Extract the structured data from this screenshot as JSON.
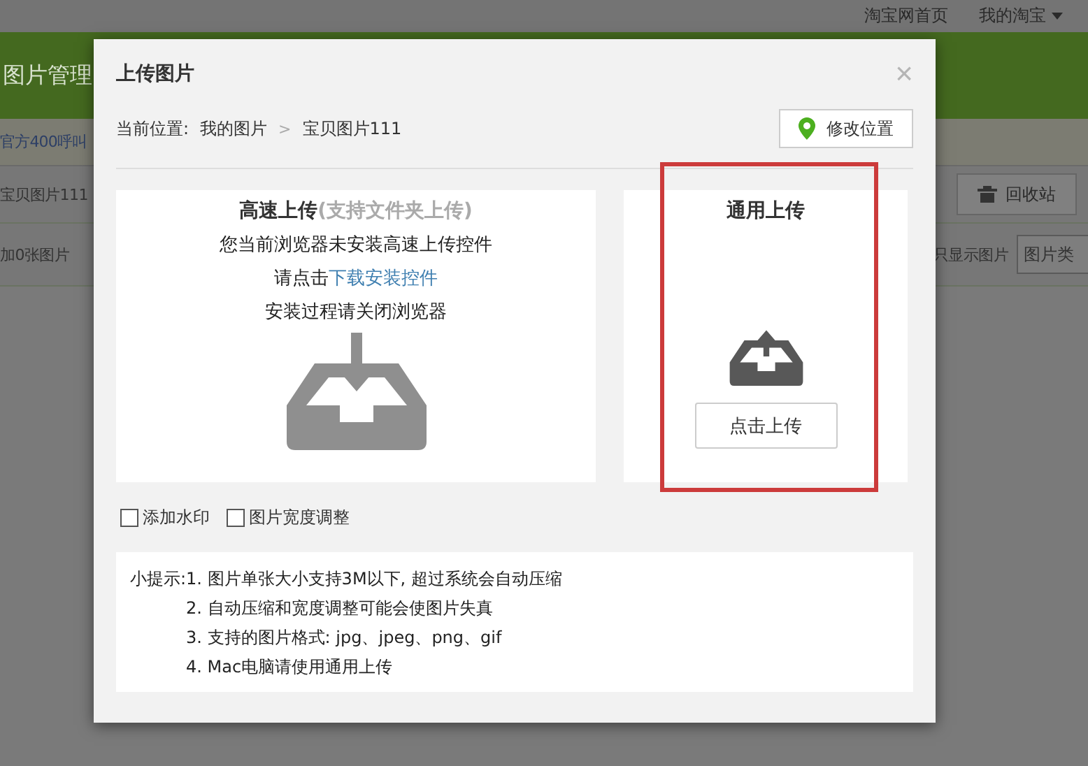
{
  "top_bar": {
    "links": [
      {
        "label": "淘宝网首页",
        "dropdown": false
      },
      {
        "label": "我的淘宝",
        "dropdown": true
      }
    ]
  },
  "header": {
    "title": "图片管理"
  },
  "notice": {
    "text": "官方400呼叫"
  },
  "folder_row": {
    "folder": "宝贝图片111",
    "buttons": [
      {
        "label": "回收站",
        "kind": "trash"
      }
    ]
  },
  "filter_row": {
    "count": "加0张图片",
    "only_images": "只显示图片",
    "type_select": "图片类"
  },
  "dialog": {
    "title": "上传图片",
    "close": "×",
    "location": {
      "label": "当前位置:",
      "path": [
        "我的图片",
        "宝贝图片111"
      ],
      "separator": ">",
      "button": "修改位置"
    },
    "fast_upload": {
      "title": "高速上传",
      "title_note": "(支持文件夹上传)",
      "lines": [
        "您当前浏览器未安装高速上传控件",
        "请点击",
        "安装过程请关闭浏览器"
      ],
      "link": "下载安装控件"
    },
    "normal_upload": {
      "title": "通用上传",
      "button": "点击上传",
      "highlighted": true
    },
    "options": [
      {
        "label": "添加水印",
        "checked": false
      },
      {
        "label": "图片宽度调整",
        "checked": false
      }
    ],
    "tips": {
      "label": "小提示:",
      "items": [
        "1. 图片单张大小支持3M以下, 超过系统会自动压缩",
        "2. 自动压缩和宽度调整可能会使图片失真",
        "3. 支持的图片格式: jpg、jpeg、png、gif",
        "4. Mac电脑请使用通用上传"
      ]
    }
  }
}
